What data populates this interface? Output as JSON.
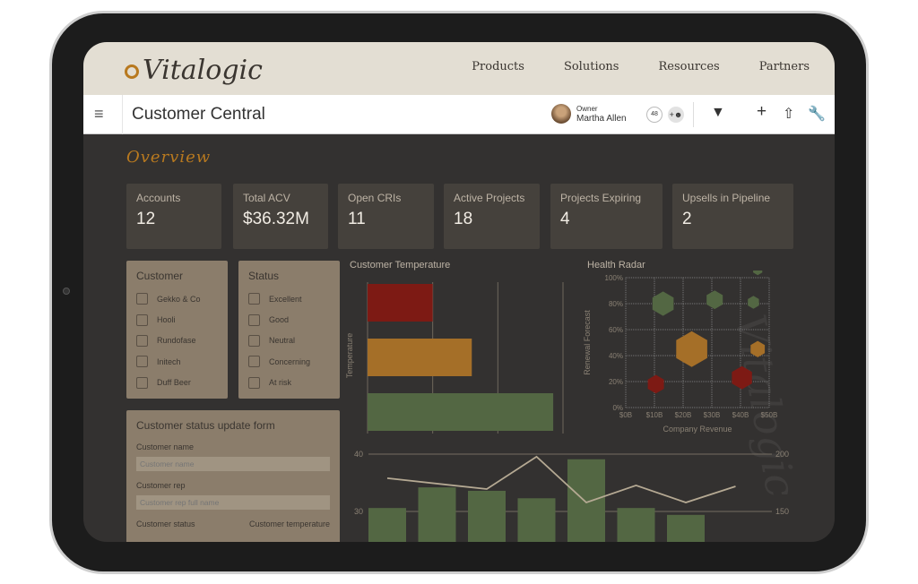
{
  "brand": {
    "name": "Vitalogic",
    "accent": "#b8791f"
  },
  "topnav": {
    "links": [
      "Products",
      "Solutions",
      "Resources",
      "Partners"
    ]
  },
  "header": {
    "title": "Customer Central",
    "owner_label": "Owner",
    "owner_name": "Martha Allen",
    "count_badge": "48",
    "icons": [
      "hamburger-menu-icon",
      "add-user-icon",
      "filter-icon",
      "plus-icon",
      "share-icon",
      "wrench-icon"
    ]
  },
  "overview_title": "Overview",
  "kpis": [
    {
      "label": "Accounts",
      "value": "12"
    },
    {
      "label": "Total ACV",
      "value": "$36.32M"
    },
    {
      "label": "Open CRIs",
      "value": "11"
    },
    {
      "label": "Active Projects",
      "value": "18"
    },
    {
      "label": "Projects Expiring",
      "value": "4"
    },
    {
      "label": "Upsells in Pipeline",
      "value": "2"
    }
  ],
  "filters": {
    "customer": {
      "title": "Customer",
      "items": [
        "Gekko & Co",
        "Hooli",
        "Rundofase",
        "Initech",
        "Duff Beer"
      ]
    },
    "status": {
      "title": "Status",
      "items": [
        "Excellent",
        "Good",
        "Neutral",
        "Concerning",
        "At risk"
      ]
    }
  },
  "form": {
    "title": "Customer status update form",
    "name_label": "Customer name",
    "name_placeholder": "Customer name",
    "rep_label": "Customer rep",
    "rep_placeholder": "Customer rep full name",
    "status_label": "Customer status",
    "temp_label": "Customer temperature"
  },
  "colors": {
    "red": "#7d1a14",
    "orange": "#a56f28",
    "green": "#536743",
    "line": "#b5a993",
    "grid": "#6f675c"
  },
  "chart_data": [
    {
      "type": "bar",
      "orientation": "horizontal",
      "title": "Customer Temperature",
      "ylabel": "Temperature",
      "xlim": [
        0,
        3
      ],
      "grid": true,
      "values": [
        1,
        1.6,
        2.85
      ],
      "colors": [
        "#7d1a14",
        "#a56f28",
        "#536743"
      ]
    },
    {
      "type": "scatter",
      "title": "Health Radar",
      "xlabel": "Company Revenue",
      "ylabel": "Renewal Forecast",
      "xlim": [
        0,
        50
      ],
      "ylim": [
        0,
        100
      ],
      "xticks": [
        "$0B",
        "$10B",
        "$20B",
        "$30B",
        "$40B",
        "$50B"
      ],
      "yticks": [
        "0%",
        "20%",
        "40%",
        "60%",
        "80%",
        "100%"
      ],
      "grid": true,
      "points": [
        {
          "x": 13,
          "y": 80,
          "size": 3,
          "color": "#536743"
        },
        {
          "x": 31,
          "y": 83,
          "size": 2,
          "color": "#536743"
        },
        {
          "x": 44.5,
          "y": 81,
          "size": 1,
          "color": "#536743"
        },
        {
          "x": 46,
          "y": 106,
          "size": 0.6,
          "color": "#536743"
        },
        {
          "x": 23,
          "y": 45,
          "size": 5,
          "color": "#a56f28"
        },
        {
          "x": 46,
          "y": 45,
          "size": 1.6,
          "color": "#a56f28"
        },
        {
          "x": 10.5,
          "y": 18,
          "size": 2,
          "color": "#7d1a14"
        },
        {
          "x": 40.5,
          "y": 23,
          "size": 2.8,
          "color": "#7d1a14"
        }
      ]
    },
    {
      "type": "bar+line",
      "yticks_left": [
        "30",
        "40"
      ],
      "yticks_right": [
        "150",
        "200"
      ],
      "ylim_left": [
        30,
        40
      ],
      "ylim_right": [
        150,
        200
      ],
      "grid": true,
      "bars": [
        30.6,
        34.2,
        33.6,
        32.3,
        39.1,
        30.6,
        29.4
      ],
      "line": [
        {
          "i": 0,
          "v": 179
        },
        {
          "i": 2,
          "v": 169.5
        },
        {
          "i": 3,
          "v": 197.7
        },
        {
          "i": 4,
          "v": 157.8
        },
        {
          "i": 5,
          "v": 172.7
        },
        {
          "i": 6,
          "v": 157.8
        },
        {
          "i": 7,
          "v": 171.9
        }
      ]
    }
  ]
}
